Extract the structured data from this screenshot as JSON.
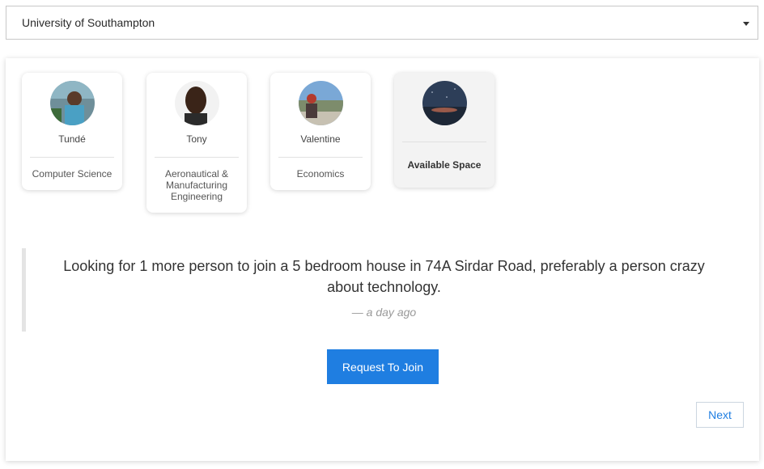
{
  "university_select": {
    "selected": "University of Southampton"
  },
  "members": [
    {
      "name": "Tundé",
      "subject": "Computer Science"
    },
    {
      "name": "Tony",
      "subject": "Aeronautical & Manufacturing Engineering"
    },
    {
      "name": "Valentine",
      "subject": "Economics"
    }
  ],
  "available_slot": {
    "label": "Available Space"
  },
  "listing": {
    "description": "Looking for 1 more person to join a 5 bedroom house in 74A Sirdar Road, preferably a person crazy about technology.",
    "posted": "— a day ago"
  },
  "actions": {
    "request_label": "Request To Join",
    "next_label": "Next"
  },
  "colors": {
    "accent": "#1f7ee1"
  }
}
